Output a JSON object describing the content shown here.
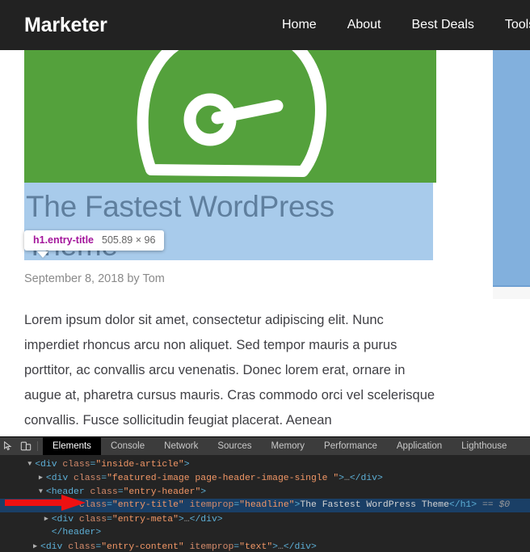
{
  "site": {
    "brand": "Marketer",
    "nav": [
      {
        "label": "Home"
      },
      {
        "label": "About"
      },
      {
        "label": "Best Deals"
      },
      {
        "label": "Tools"
      }
    ],
    "header_bg": "#222222"
  },
  "article": {
    "featured_image": {
      "icon": "speedometer-gauge-icon",
      "bg_color": "#54a13c",
      "icon_color": "#ffffff"
    },
    "title": "The Fastest WordPress Theme",
    "meta": "September 8, 2018 by Tom",
    "body": "Lorem ipsum dolor sit amet, consectetur adipiscing elit. Nunc imperdiet rhoncus arcu non aliquet. Sed tempor mauris a purus porttitor, ac convallis arcu venenatis. Donec lorem erat, ornare in augue at, pharetra cursus mauris. Cras commodo orci vel scelerisque convallis. Fusce sollicitudin feugiat placerat. Aenean"
  },
  "inspect_badge": {
    "selector": "h1.entry-title",
    "dimensions": "505.89 × 96",
    "highlight_color": "#a8cbeb"
  },
  "sidebar": {
    "highlight_color": "#82b0dd"
  },
  "devtools": {
    "icons": [
      {
        "name": "inspect-element-icon"
      },
      {
        "name": "device-toolbar-icon"
      }
    ],
    "tabs": [
      {
        "label": "Elements",
        "active": true
      },
      {
        "label": "Console",
        "active": false
      },
      {
        "label": "Network",
        "active": false
      },
      {
        "label": "Sources",
        "active": false
      },
      {
        "label": "Memory",
        "active": false
      },
      {
        "label": "Performance",
        "active": false
      },
      {
        "label": "Application",
        "active": false
      },
      {
        "label": "Lighthouse",
        "active": false
      }
    ],
    "dom_rows": [
      {
        "indent": 5,
        "triangle": "▼",
        "open_tag": "<div",
        "attrs": [
          {
            "name": "class",
            "value": "inside-article"
          }
        ],
        "close_bracket": ">",
        "text": "",
        "ellipsis": false,
        "close_tag": "",
        "suffix": "",
        "selected": false
      },
      {
        "indent": 7,
        "triangle": "▶",
        "open_tag": "<div",
        "attrs": [
          {
            "name": "class",
            "value": "featured-image  page-header-image-single "
          }
        ],
        "close_bracket": ">",
        "text": "",
        "ellipsis": true,
        "close_tag": "</div>",
        "suffix": "",
        "selected": false
      },
      {
        "indent": 7,
        "triangle": "▼",
        "open_tag": "<header",
        "attrs": [
          {
            "name": "class",
            "value": "entry-header"
          }
        ],
        "close_bracket": ">",
        "text": "",
        "ellipsis": false,
        "close_tag": "",
        "suffix": "",
        "selected": false
      },
      {
        "indent": 9,
        "triangle": "",
        "open_tag": "<h1",
        "attrs": [
          {
            "name": "class",
            "value": "entry-title"
          },
          {
            "name": "itemprop",
            "value": "headline"
          }
        ],
        "close_bracket": ">",
        "text": "The Fastest WordPress Theme",
        "ellipsis": false,
        "close_tag": "</h1>",
        "suffix": " == $0",
        "selected": true
      },
      {
        "indent": 8,
        "triangle": "▶",
        "open_tag": "<div",
        "attrs": [
          {
            "name": "class",
            "value": "entry-meta"
          }
        ],
        "close_bracket": ">",
        "text": "",
        "ellipsis": true,
        "close_tag": "</div>",
        "suffix": "",
        "selected": false
      },
      {
        "indent": 8,
        "triangle": "",
        "open_tag": "</header>",
        "attrs": [],
        "close_bracket": "",
        "text": "",
        "ellipsis": false,
        "close_tag": "",
        "suffix": "",
        "selected": false
      },
      {
        "indent": 6,
        "triangle": "▶",
        "open_tag": "<div",
        "attrs": [
          {
            "name": "class",
            "value": "entry-content"
          },
          {
            "name": "itemprop",
            "value": "text"
          }
        ],
        "close_bracket": ">",
        "text": "",
        "ellipsis": true,
        "close_tag": "</div>",
        "suffix": "",
        "selected": false
      }
    ]
  },
  "annotation": {
    "arrow_color": "#ee1111",
    "name": "red-arrow-pointing-to-selected-node"
  }
}
